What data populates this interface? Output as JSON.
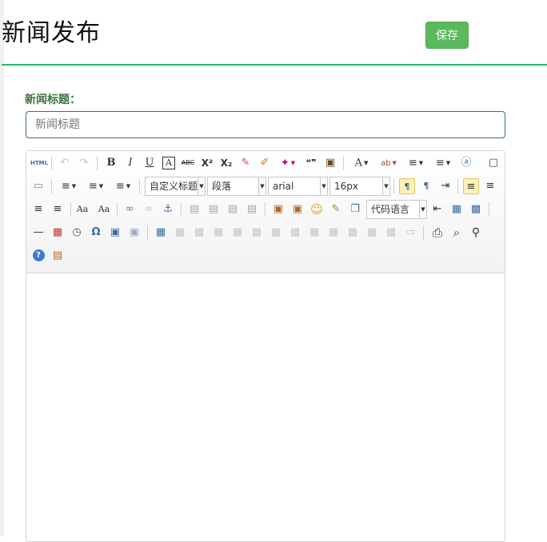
{
  "page": {
    "title": "新闻发布",
    "save_label": "保存"
  },
  "form": {
    "title_label": "新闻标题：",
    "title_placeholder": "新闻标题"
  },
  "editor": {
    "html_label": "HTML",
    "font_family_value": "arial",
    "font_size_value": "16px",
    "custom_heading_value": "自定义标题",
    "paragraph_value": "段落",
    "code_lang_value": "代码语言",
    "glyphs": {
      "undo": "↶",
      "redo": "↷",
      "bold": "B",
      "italic": "I",
      "underline": "U",
      "font_border": "A",
      "strikethrough": "ABC",
      "superscript": "X²",
      "subscript": "X₂",
      "eraser": "✎",
      "brush": "✐",
      "wand": "✦",
      "quote": "❝❞",
      "paste": "▣",
      "forecolor": "A",
      "backcolor": "ab",
      "ol": "≡",
      "ul": "≡",
      "select_all": "ⓐ",
      "preview": "▢",
      "new_doc": "▭",
      "row_spacing_top": "≡",
      "row_spacing_bottom": "≡",
      "line_height": "≡",
      "dir_ltr": "¶",
      "dir_rtl": "¶",
      "indent": "⇥",
      "align_left": "≡",
      "align_center": "≡",
      "align_right": "≡",
      "align_justify": "≡",
      "to_upper": "Aa",
      "to_lower": "Aa",
      "link": "∞",
      "unlink": "∞",
      "anchor": "⚓",
      "img_none": "▤",
      "img_left": "▤",
      "img_right": "▤",
      "img_center": "▤",
      "image": "▣",
      "multi_image": "▣",
      "emotion": "☺",
      "scrawl": "✎",
      "insert_code": "❐",
      "page_break": "⇤",
      "template": "▦",
      "background": "▩",
      "hr": "—",
      "date": "▦",
      "time": "◷",
      "omega": "Ω",
      "attach": "▣",
      "wordimage": "▣",
      "table": "▦",
      "del_table": "▦",
      "insert_para": "▦",
      "insert_row": "▦",
      "insert_col": "▦",
      "merge": "▦",
      "split": "▦",
      "t1": "▦",
      "t2": "▦",
      "t3": "▦",
      "t4": "▦",
      "t5": "▦",
      "t6": "▦",
      "chart": "▭",
      "print": "⎙",
      "search": "⌕",
      "find": "⚲",
      "help": "?",
      "draft": "▤"
    }
  },
  "colors": {
    "accent_green": "#5cb85c",
    "rule_green": "#2bb673",
    "label_green": "#3c763d"
  }
}
